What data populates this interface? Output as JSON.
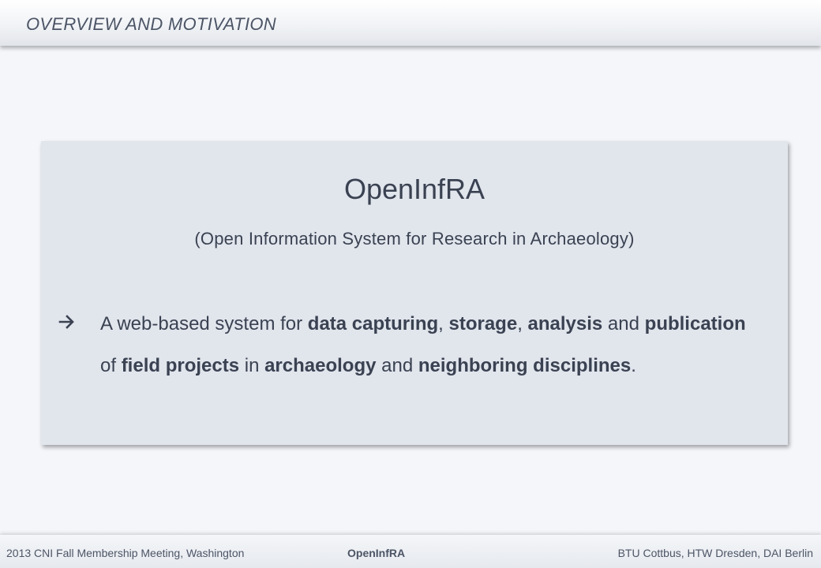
{
  "header": {
    "title": "OVERVIEW AND MOTIVATION"
  },
  "box": {
    "title": "OpenInfRA",
    "subtitle": "(Open Information System for Research in Archaeology)",
    "bullet_icon": "arrow-right-icon",
    "bullet": {
      "t1": "A web-based system for ",
      "b1": "data capturing",
      "t2": ", ",
      "b2": "storage",
      "t3": ", ",
      "b3": "analysis",
      "t4": " and ",
      "b4": "publication",
      "t5": " of ",
      "b5": "field projects",
      "t6": " in ",
      "b6": "archaeology",
      "t7": " and ",
      "b7": "neighboring disciplines",
      "t8": "."
    }
  },
  "footer": {
    "left": "2013 CNI Fall Membership Meeting, Washington",
    "center": "OpenInfRA",
    "right": "BTU Cottbus, HTW Dresden, DAI Berlin"
  },
  "colors": {
    "background": "#f4f6fa",
    "box": "#e1e5ec",
    "text": "#3a4252"
  }
}
